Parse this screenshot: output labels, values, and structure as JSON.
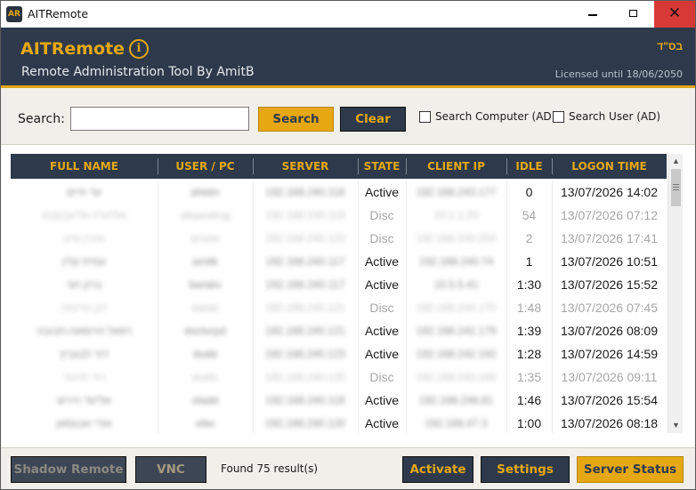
{
  "window": {
    "title": "AITRemote",
    "icon_text": "AR",
    "close_glyph": "✕"
  },
  "header": {
    "app_title": "AITRemote",
    "info_glyph": "i",
    "subtitle": "Remote Administration Tool By AmitB",
    "hebrew_mark": "בס\"ד",
    "license": "Licensed until 18/06/2050"
  },
  "search": {
    "label": "Search:",
    "value": "",
    "search_button": "Search",
    "clear_button": "Clear",
    "search_computer_label": "Search Computer (AD)",
    "search_computer_checked": false,
    "search_user_label": "Search User (AD)",
    "search_user_checked": false
  },
  "grid": {
    "columns": [
      "FULL NAME",
      "USER / PC",
      "SERVER",
      "STATE",
      "CLIENT IP",
      "IDLE",
      "LOGON TIME"
    ],
    "rows": [
      {
        "full_name": "עד חיים",
        "user_pc": "ahidm",
        "server": "192.168.240.118",
        "state": "Active",
        "client_ip": "192.168.243.177",
        "idle": "0",
        "logon_time": "13/07/2026 14:02"
      },
      {
        "full_name": "אלחורה אליעבנקים",
        "user_pc": "alejandrog",
        "server": "192.168.240.119",
        "state": "Disc",
        "client_ip": "10.1.1.20",
        "idle": "54",
        "logon_time": "13/07/2026 07:12"
      },
      {
        "full_name": "אהרן מיט",
        "user_pc": "aroow",
        "server": "192.168.240.122",
        "state": "Disc",
        "client_ip": "192.168.240.254",
        "idle": "2",
        "logon_time": "13/07/2026 17:41"
      },
      {
        "full_name": "עמית קלין",
        "user_pc": "amitk",
        "server": "192.168.240.117",
        "state": "Active",
        "client_ip": "192.168.240.74",
        "idle": "1",
        "logon_time": "13/07/2026 10:51"
      },
      {
        "full_name": "ברק חגי",
        "user_pc": "barakv",
        "server": "192.168.240.117",
        "state": "Active",
        "client_ip": "10.5.5.41",
        "idle": "1:30",
        "logon_time": "13/07/2026 15:52"
      },
      {
        "full_name": "דגן מרומה",
        "user_pc": "danar",
        "server": "192.168.240.121",
        "state": "Disc",
        "client_ip": "192.168.244.170",
        "idle": "1:48",
        "logon_time": "13/07/2026 07:45"
      },
      {
        "full_name": "רפאל הרופאה-חבובה",
        "user_pc": "doctorpd",
        "server": "192.168.240.121",
        "state": "Active",
        "client_ip": "192.168.242.179",
        "idle": "1:39",
        "logon_time": "13/07/2026 08:09"
      },
      {
        "full_name": "דור לבגביץ",
        "user_pc": "dudd",
        "server": "192.168.240.123",
        "state": "Active",
        "client_ip": "192.168.242.192",
        "idle": "1:28",
        "logon_time": "13/07/2026 14:59"
      },
      {
        "full_name": "דוד לוינגר",
        "user_pc": "dudis",
        "server": "192.168.240.120",
        "state": "Disc",
        "client_ip": "192.168.243.160",
        "idle": "1:35",
        "logon_time": "13/07/2026 09:11"
      },
      {
        "full_name": "אליעד הירש",
        "user_pc": "eladd",
        "server": "192.168.240.119",
        "state": "Active",
        "client_ip": "192.168.246.81",
        "idle": "1:46",
        "logon_time": "13/07/2026 15:54"
      },
      {
        "full_name": "אודי אבגמאן",
        "user_pc": "eliw",
        "server": "192.168.240.120",
        "state": "Active",
        "client_ip": "192.168.47.3",
        "idle": "1:00",
        "logon_time": "13/07/2026 08:18"
      }
    ]
  },
  "footer": {
    "shadow_button": "Shadow Remote",
    "vnc_button": "VNC",
    "found_text": "Found 75 result(s)",
    "activate_button": "Activate",
    "settings_button": "Settings",
    "server_status_button": "Server Status"
  },
  "colors": {
    "accent_gold": "#e5a813",
    "navy": "#2e3a4b",
    "close_red": "#d73a36",
    "disc_text": "#a6a6a6"
  },
  "icons": {
    "app": "app-logo-icon",
    "info": "info-circle-icon",
    "minimize": "minimize-icon",
    "maximize": "maximize-icon",
    "close": "close-icon",
    "scroll_up": "chevron-up-icon",
    "scroll_down": "chevron-down-icon"
  }
}
